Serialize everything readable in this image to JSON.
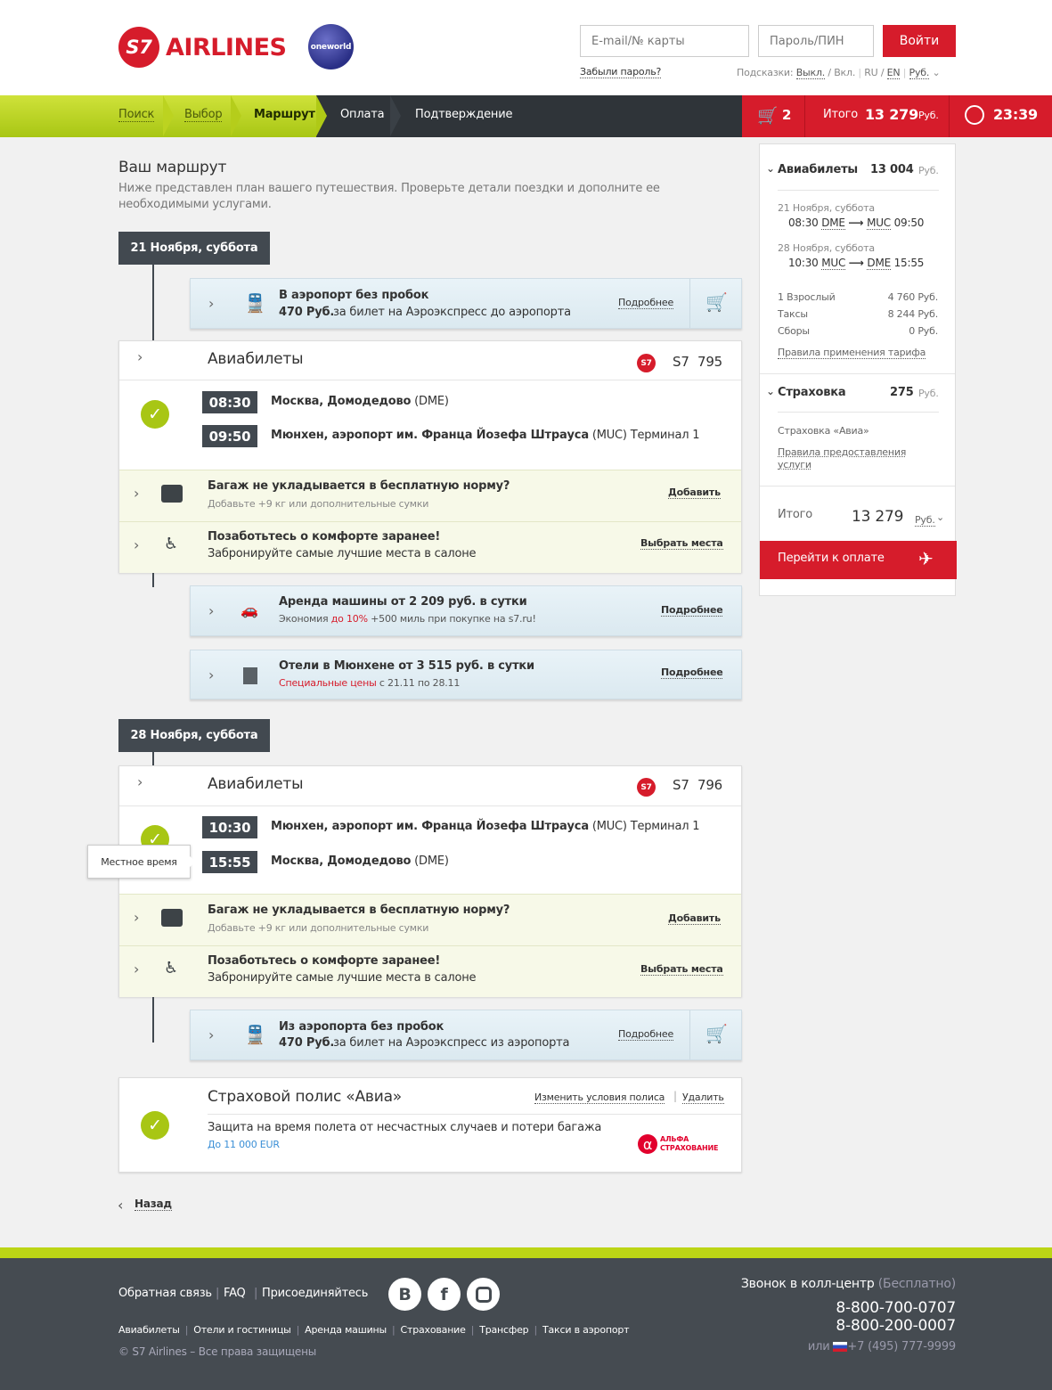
{
  "header": {
    "brand": "AIRLINES",
    "logo_mark": "S7",
    "oneworld": "oneworld",
    "email_placeholder": "E-mail/№ карты",
    "password_placeholder": "Пароль/ПИН",
    "login_label": "Войти",
    "forgot": "Забыли пароль?",
    "hints_label": "Подсказки:",
    "hints_off": "Выкл.",
    "hints_on": "Вкл.",
    "lang_ru": "RU",
    "lang_en": "EN",
    "currency": "Руб."
  },
  "steps": {
    "search": "Поиск",
    "select": "Выбор",
    "route": "Маршрут",
    "payment": "Оплата",
    "confirm": "Подтверждение"
  },
  "cart": {
    "count": "2",
    "total_label": "Итого",
    "total": "13 279",
    "currency": "Руб.",
    "timer": "23:39"
  },
  "page": {
    "title": "Ваш маршрут",
    "desc": "Ниже представлен план вашего путешествия. Проверьте детали поездки и дополните ее необходимыми услугами."
  },
  "outbound": {
    "date": "21 Ноября, суббота",
    "express": {
      "title": "В аэропорт без пробок",
      "price": "470 Руб.",
      "text": "за билет на Аэроэкспресс до аэропорта",
      "more": "Подробнее"
    },
    "flight": {
      "title": "Авиабилеты",
      "code": "S7",
      "number": "795",
      "dep_time": "08:30",
      "dep_place": "Москва, Домодедово",
      "dep_code": "(DME)",
      "arr_time": "09:50",
      "arr_place": "Мюнхен, аэропорт им. Франца Йозефа Штрауса",
      "arr_code": "(MUC) Терминал 1"
    },
    "baggage": {
      "title": "Багаж не укладывается в бесплатную норму?",
      "sub": "Добавьте +9 кг или дополнительные сумки",
      "action": "Добавить"
    },
    "seats": {
      "title": "Позаботьтесь о комфорте заранее!",
      "sub": "Забронируйте самые лучшие места в салоне",
      "action": "Выбрать места"
    },
    "car": {
      "title": "Аренда машины от 2 209 руб. в сутки",
      "sub1": "Экономия",
      "sub_red": "до 10%",
      "sub2": "+500 миль при покупке на s7.ru!",
      "more": "Подробнее"
    },
    "hotel": {
      "title": "Отели в Мюнхене от 3 515 руб. в сутки",
      "sub_red": "Специальные цены",
      "sub2": "с 21.11 по 28.11",
      "more": "Подробнее"
    }
  },
  "inbound": {
    "date": "28 Ноября, суббота",
    "flight": {
      "title": "Авиабилеты",
      "code": "S7",
      "number": "796",
      "dep_time": "10:30",
      "dep_place": "Мюнхен, аэропорт им. Франца Йозефа Штрауса",
      "dep_code": "(MUC) Терминал 1",
      "arr_time": "15:55",
      "arr_place": "Москва, Домодедово",
      "arr_code": "(DME)",
      "tooltip": "Местное время"
    },
    "baggage": {
      "title": "Багаж не укладывается в бесплатную норму?",
      "sub": "Добавьте +9 кг или дополнительные сумки",
      "action": "Добавить"
    },
    "seats": {
      "title": "Позаботьтесь о комфорте заранее!",
      "sub": "Забронируйте самые лучшие места в салоне",
      "action": "Выбрать места"
    },
    "express": {
      "title": "Из аэропорта без пробок",
      "price": "470 Руб.",
      "text": "за билет на Аэроэкспресс из аэропорта",
      "more": "Подробнее"
    }
  },
  "insurance": {
    "title": "Страховой полис «Авиа»",
    "change": "Изменить условия полиса",
    "sep": "|",
    "delete": "Удалить",
    "text": "Защита на время полета от несчастных случаев и потери багажа",
    "limit": "До 11 000 EUR",
    "partner1": "АЛЬФА",
    "partner2": "СТРАХОВАНИЕ"
  },
  "back": "Назад",
  "sidebar": {
    "tickets_label": "Авиабилеты",
    "tickets_sum": "13 004",
    "cur": "Руб.",
    "seg1_date": "21 Ноября, суббота",
    "seg1_dep": "08:30",
    "seg1_from": "DME",
    "seg1_to": "MUC",
    "seg1_arr": "09:50",
    "seg2_date": "28 Ноября, суббота",
    "seg2_dep": "10:30",
    "seg2_from": "MUC",
    "seg2_to": "DME",
    "seg2_arr": "15:55",
    "adult": "1 Взрослый",
    "adult_sum": "4 760 Руб.",
    "taxes": "Таксы",
    "taxes_sum": "8 244 Руб.",
    "fees": "Сборы",
    "fees_sum": "0 Руб.",
    "rules": "Правила применения тарифа",
    "ins_label": "Страховка",
    "ins_sum": "275",
    "ins_name": "Страховка «Авиа»",
    "ins_rules": "Правила предоставления услуги",
    "total_label": "Итого",
    "total": "13 279",
    "total_cur": "Руб.",
    "pay": "Перейти к оплате"
  },
  "footer": {
    "feedback": "Обратная связь",
    "faq": "FAQ",
    "join": "Присоединяйтесь",
    "links": [
      "Авиабилеты",
      "Отели и гостиницы",
      "Аренда машины",
      "Страхование",
      "Трансфер",
      "Такси в аэропорт"
    ],
    "copyright": "© S7 Airlines – Все права защищены",
    "call": "Звонок в колл-центр",
    "free": "(Бесплатно)",
    "phone1": "8-800-700-0707",
    "phone2": "8-800-200-0007",
    "or": "или",
    "phone3": "+7 (495) 777-9999",
    "vk": "B",
    "fb": "f"
  },
  "colors": {
    "brand_red": "#d61c2b",
    "lime": "#a8c614",
    "dark": "#424950"
  }
}
